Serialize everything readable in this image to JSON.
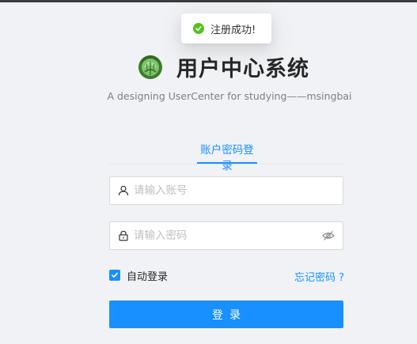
{
  "toast": {
    "message": "注册成功!",
    "status_color": "#52c41a",
    "icon": "check-circle-icon"
  },
  "brand": {
    "title": "用户中心系统",
    "subtitle": "A designing UserCenter for studying——msingbai",
    "logo_icon": "cabbage-logo-icon"
  },
  "tabs": [
    {
      "label": "账户密码登录",
      "active": true
    }
  ],
  "form": {
    "account_placeholder": "请输入账号",
    "account_value": "",
    "account_icon": "user-icon",
    "password_placeholder": "请输入密码",
    "password_value": "",
    "password_icon": "lock-icon",
    "visibility_icon": "eye-invisible-icon",
    "remember_label": "自动登录",
    "remember_checked": true,
    "forgot_label": "忘记密码 ?",
    "submit_label": "登录"
  },
  "colors": {
    "accent": "#1890ff",
    "background": "#f0f2f5"
  }
}
